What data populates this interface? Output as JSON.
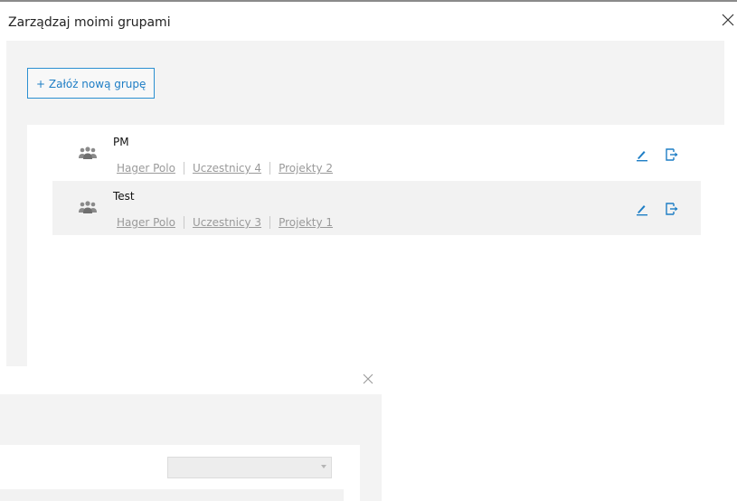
{
  "dialog": {
    "title": "Zarządzaj moimi grupami"
  },
  "toolbar": {
    "new_group_label": "+ Załóż nową grupę"
  },
  "groups": [
    {
      "name": "PM",
      "company": "Hager Polo",
      "participants": "Uczestnicy 4",
      "projects": "Projekty 2"
    },
    {
      "name": "Test",
      "company": "Hager Polo",
      "participants": "Uczestnicy 3",
      "projects": "Projekty 1"
    }
  ],
  "sub_dialog": {
    "select_value": ""
  },
  "colors": {
    "accent": "#1e7ec5",
    "link_gray": "#9a9a9a",
    "panel_bg": "#f3f3f3",
    "row_alt_bg": "#f2f2f2"
  },
  "icons": {
    "close": "close-icon",
    "group": "group-icon",
    "edit": "pencil-icon",
    "leave": "leave-group-icon",
    "dropdown": "chevron-down-icon"
  }
}
